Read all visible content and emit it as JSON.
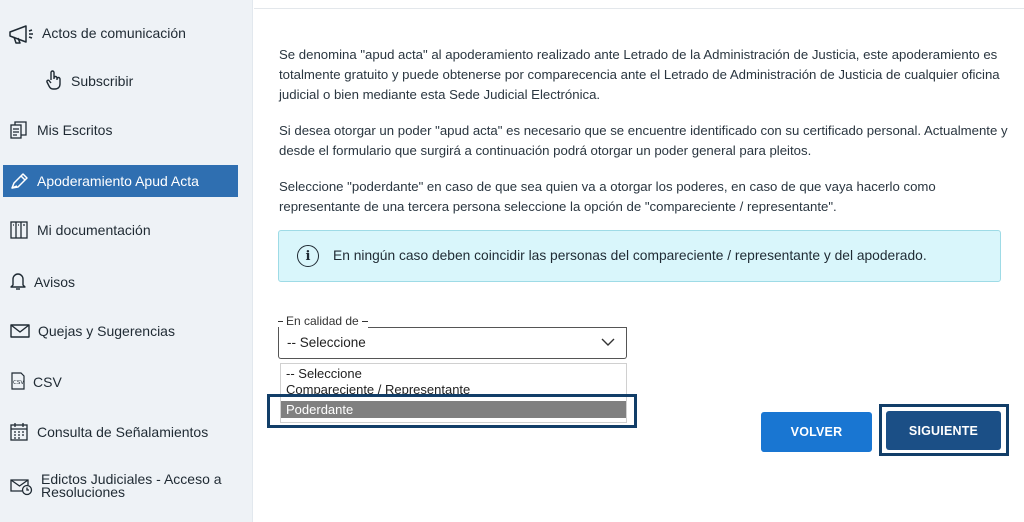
{
  "sidebar": {
    "items": [
      {
        "label": "Actos de comunicación",
        "icon": "megaphone-icon"
      },
      {
        "label": "Subscribir",
        "icon": "hand-pointer-icon"
      },
      {
        "label": "Mis Escritos",
        "icon": "documents-icon"
      },
      {
        "label": "Apoderamiento Apud Acta",
        "icon": "pen-icon",
        "active": true
      },
      {
        "label": "Mi documentación",
        "icon": "folder-book-icon"
      },
      {
        "label": "Avisos",
        "icon": "bell-icon"
      },
      {
        "label": "Quejas y Sugerencias",
        "icon": "envelope-icon"
      },
      {
        "label": "CSV",
        "icon": "csv-file-icon"
      },
      {
        "label": "Consulta de Señalamientos",
        "icon": "calendar-icon"
      },
      {
        "label": "Edictos Judiciales - Acceso a Resoluciones",
        "icon": "mail-clock-icon"
      }
    ]
  },
  "main": {
    "paragraphs": [
      "Se denomina \"apud acta\" al apoderamiento realizado ante Letrado de la Administración de Justicia, este apoderamiento es totalmente gratuito y puede obtenerse por comparecencia ante el Letrado de Administración de Justicia de cualquier oficina judicial o bien mediante esta Sede Judicial Electrónica.",
      "Si desea otorgar un poder \"apud acta\" es necesario que se encuentre identificado con su certificado personal. Actualmente y desde el formulario que surgirá a continuación podrá otorgar un poder general para pleitos.",
      "Seleccione \"poderdante\" en caso de que sea quien va a otorgar los poderes, en caso de que vaya hacerlo como representante de una tercera persona seleccione la opción de \"compareciente / representante\"."
    ],
    "alert": {
      "icon": "info-icon",
      "text": "En ningún caso deben coincidir las personas del compareciente / representante y del apoderado."
    },
    "select": {
      "label": "En calidad de",
      "value": "-- Seleccione",
      "options": [
        "-- Seleccione",
        "Compareciente / Representante",
        "Poderdante"
      ],
      "highlighted_option": "Poderdante"
    },
    "buttons": {
      "back": "VOLVER",
      "next": "SIGUIENTE"
    },
    "colors": {
      "sidebar_active": "#2f6fb1",
      "alert_bg": "#d9f6fb",
      "button_back": "#1976d2",
      "button_next": "#1b4f86",
      "highlight_frame": "#123e68"
    }
  }
}
